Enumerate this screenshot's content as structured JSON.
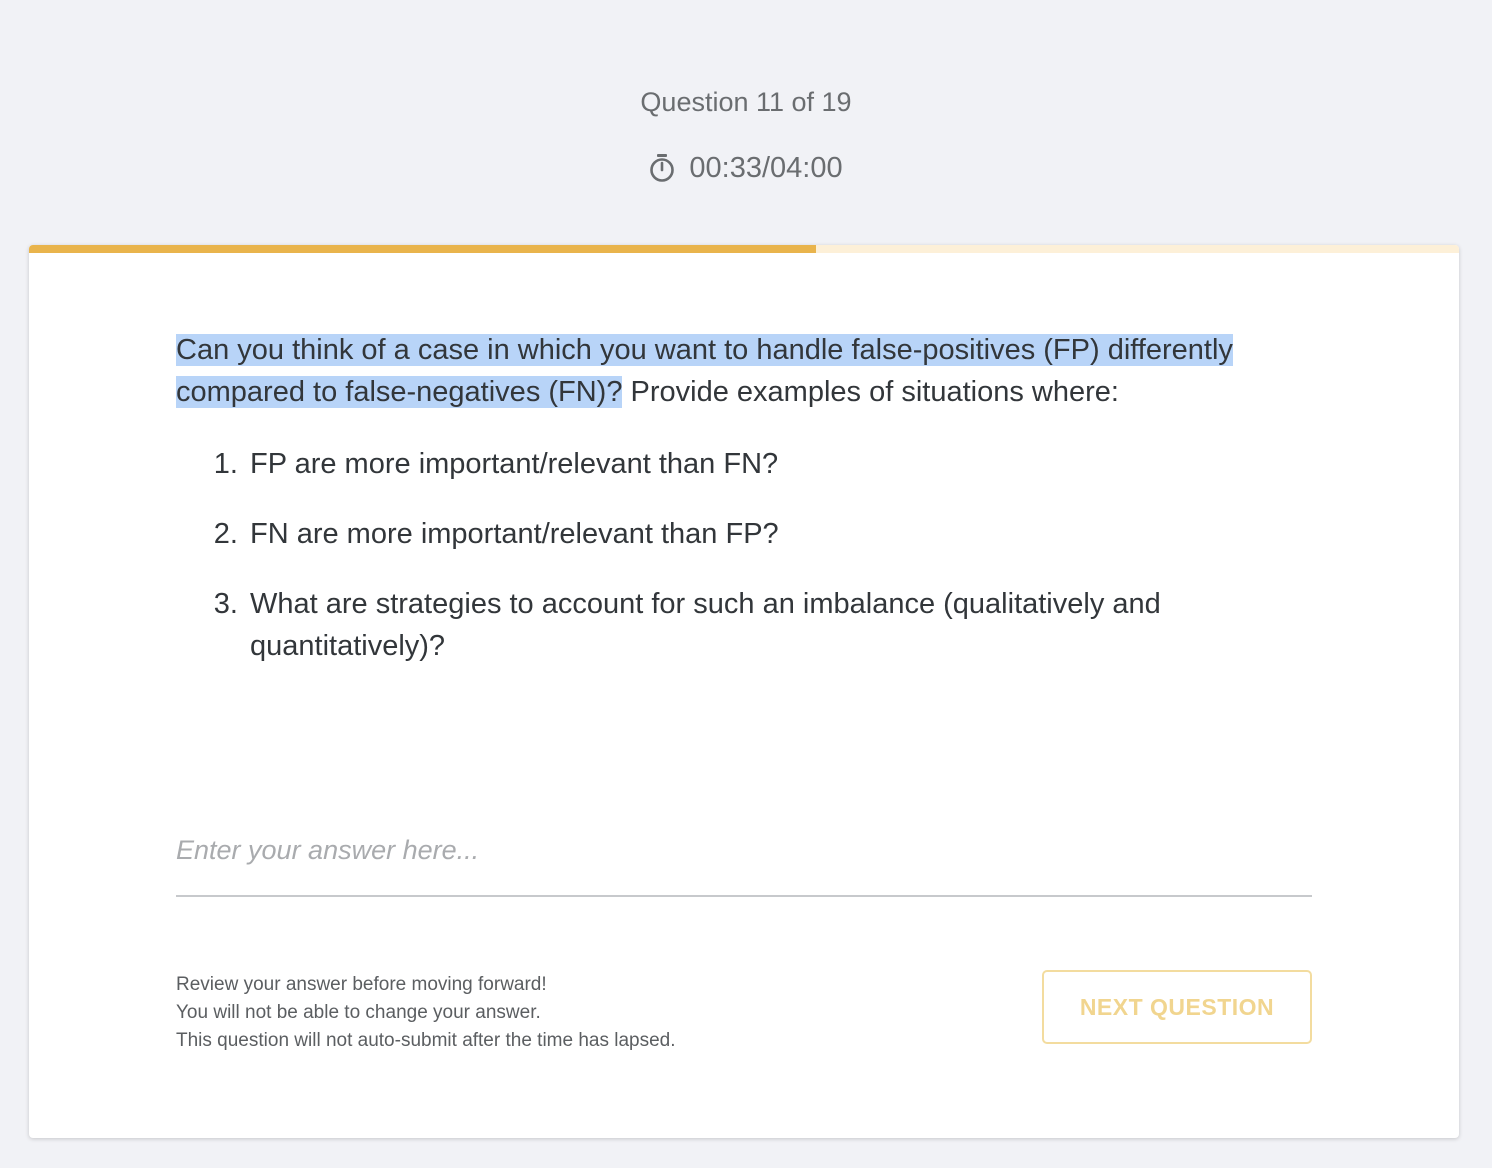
{
  "header": {
    "question_counter": "Question 11 of 19",
    "timer": "00:33/04:00",
    "timer_icon": "stopwatch-icon"
  },
  "progress": {
    "fraction": 0.55,
    "fill_color": "#e9b44c",
    "track_color": "#fdf0d8"
  },
  "question": {
    "highlighted_text": "Can you think of a case in which you want to handle false-positives (FP) differently compared to false-negatives (FN)?",
    "rest_text": " Provide examples of situations where:",
    "items": [
      "FP are more important/relevant than FN?",
      "FN are more important/relevant than FP?",
      "What are strategies to account for such an imbalance (qualitatively and quantitatively)?"
    ]
  },
  "answer": {
    "placeholder": "Enter your answer here...",
    "value": ""
  },
  "footer": {
    "notes": [
      "Review your answer before moving forward!",
      "You will not be able to change your answer.",
      "This question will not auto-submit after the time has lapsed."
    ],
    "next_label": "NEXT QUESTION"
  },
  "colors": {
    "page_background": "#f1f2f6",
    "highlight": "#b8d4f8",
    "button_disabled_text": "#f1d58f"
  }
}
